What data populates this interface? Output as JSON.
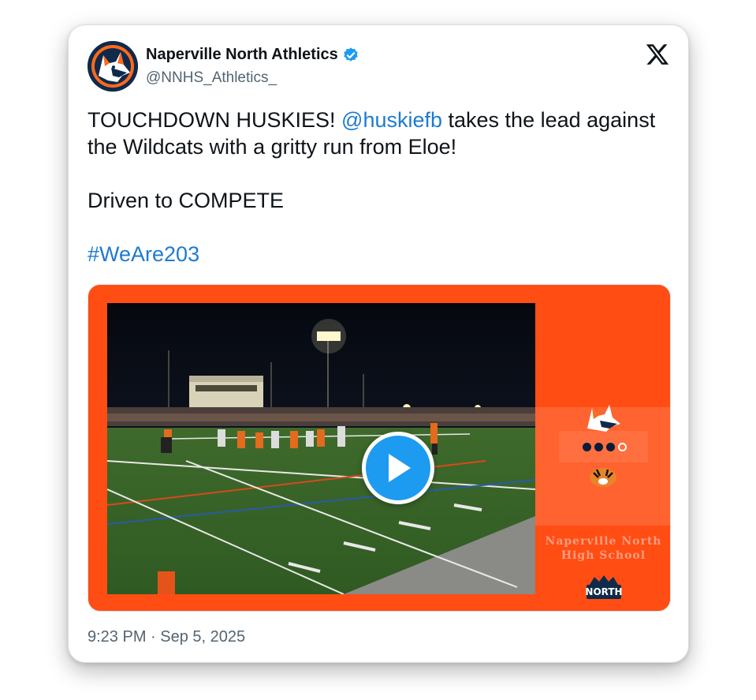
{
  "tweet": {
    "author_name": "Naperville North Athletics",
    "handle": "@NNHS_Athletics_",
    "text": {
      "line1_start": "TOUCHDOWN HUSKIES! ",
      "mention": "@huskiefb",
      "line1_end": " takes the lead against",
      "line2": "the Wildcats with a gritty run from Eloe!",
      "line3": "Driven to COMPETE",
      "hashtag": "#WeAre203"
    },
    "timestamp": "9:23 PM · Sep 5, 2025"
  },
  "media": {
    "type": "video",
    "sidebar_text_line1": "Naperville North",
    "sidebar_text_line2": "High School",
    "sidebar_logo_text": "NORTH",
    "progress_dots_filled": 3,
    "progress_dots_total": 4
  },
  "icons": {
    "verified": "verified-badge-icon",
    "x_logo": "x-logo-icon",
    "play": "play-icon"
  },
  "colors": {
    "link": "#1d7bd0",
    "verified": "#1d9bf0",
    "media_background": "#ff4d14",
    "play_button": "#1d9bf0"
  }
}
